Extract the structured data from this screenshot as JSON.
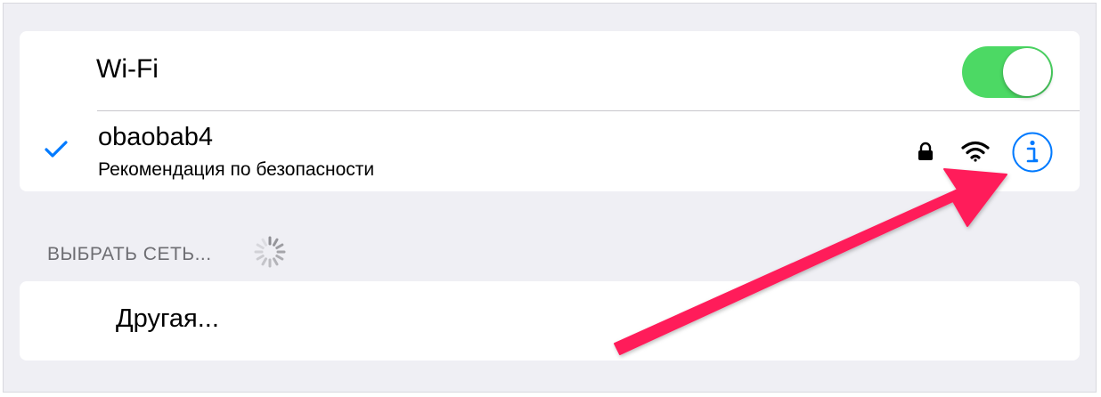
{
  "wifi": {
    "label": "Wi-Fi",
    "enabled": true,
    "toggle_color": "#4cd964"
  },
  "current_network": {
    "name": "obaobab4",
    "subtitle": "Рекомендация по безопасности",
    "connected": true,
    "secured": true,
    "icons": [
      "checkmark-icon",
      "lock-icon",
      "wifi-signal-icon",
      "info-icon"
    ],
    "accent_color": "#007aff"
  },
  "choose_network": {
    "header": "ВЫБРАТЬ СЕТЬ...",
    "loading": true
  },
  "other": {
    "label": "Другая..."
  },
  "annotation": {
    "icon": "arrow-icon",
    "color": "#ff1f5a"
  }
}
